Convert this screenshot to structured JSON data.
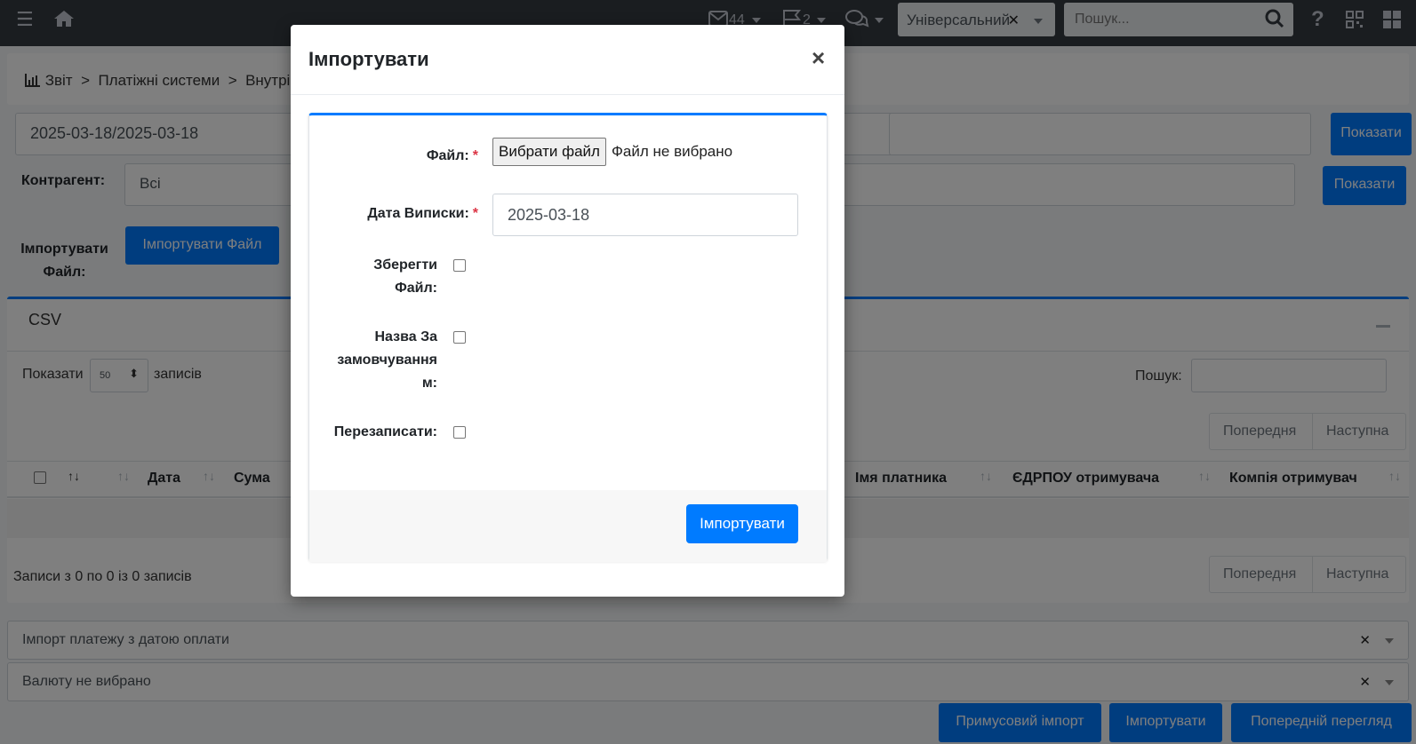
{
  "navbar": {
    "mail_count": "44",
    "flag_count": "2",
    "profile_select": "Універсальний",
    "search_placeholder": "Пошук..."
  },
  "breadcrumb": {
    "items": [
      "Звіт",
      "Платіжні системи",
      "Внутріш"
    ]
  },
  "filters": {
    "date_range": "2025-03-18/2025-03-18",
    "show_label": "Показати",
    "counterparty_label": "Контрагент:",
    "counterparty_value": "Всі",
    "import_file_label": "Імпортувати Файл:",
    "import_file_button": "Імпортувати Файл"
  },
  "csv_panel": {
    "title": "CSV",
    "show_prefix": "Показати",
    "page_length": "50",
    "show_suffix": "записів",
    "search_label": "Пошук:",
    "prev": "Попередня",
    "next": "Наступна",
    "columns": [
      "Дата",
      "Сума",
      "Імя платника",
      "ЄДРПОУ отримувача",
      "Компія отримувач"
    ],
    "info": "Записи з 0 по 0 із 0 записів"
  },
  "bottom": {
    "import_mode": "Імпорт платежу з датою оплати",
    "currency": "Валюту не вибрано",
    "force_import": "Примусовий імпорт",
    "import": "Імпортувати",
    "preview": "Попередній перегляд"
  },
  "modal": {
    "title": "Імпортувати",
    "close": "×",
    "file_label": "Файл:",
    "required_mark": "*",
    "choose_file": "Вибрати файл",
    "no_file": "Файл не вибрано",
    "statement_date_label": "Дата Виписки:",
    "statement_date": "2025-03-18",
    "save_file_label_1": "Зберегти",
    "save_file_label_2": "Файл:",
    "default_name_label_1": "Назва За",
    "default_name_label_2": "замовчування",
    "default_name_label_3": "м:",
    "overwrite_label": "Перезаписати:",
    "submit": "Імпортувати"
  }
}
